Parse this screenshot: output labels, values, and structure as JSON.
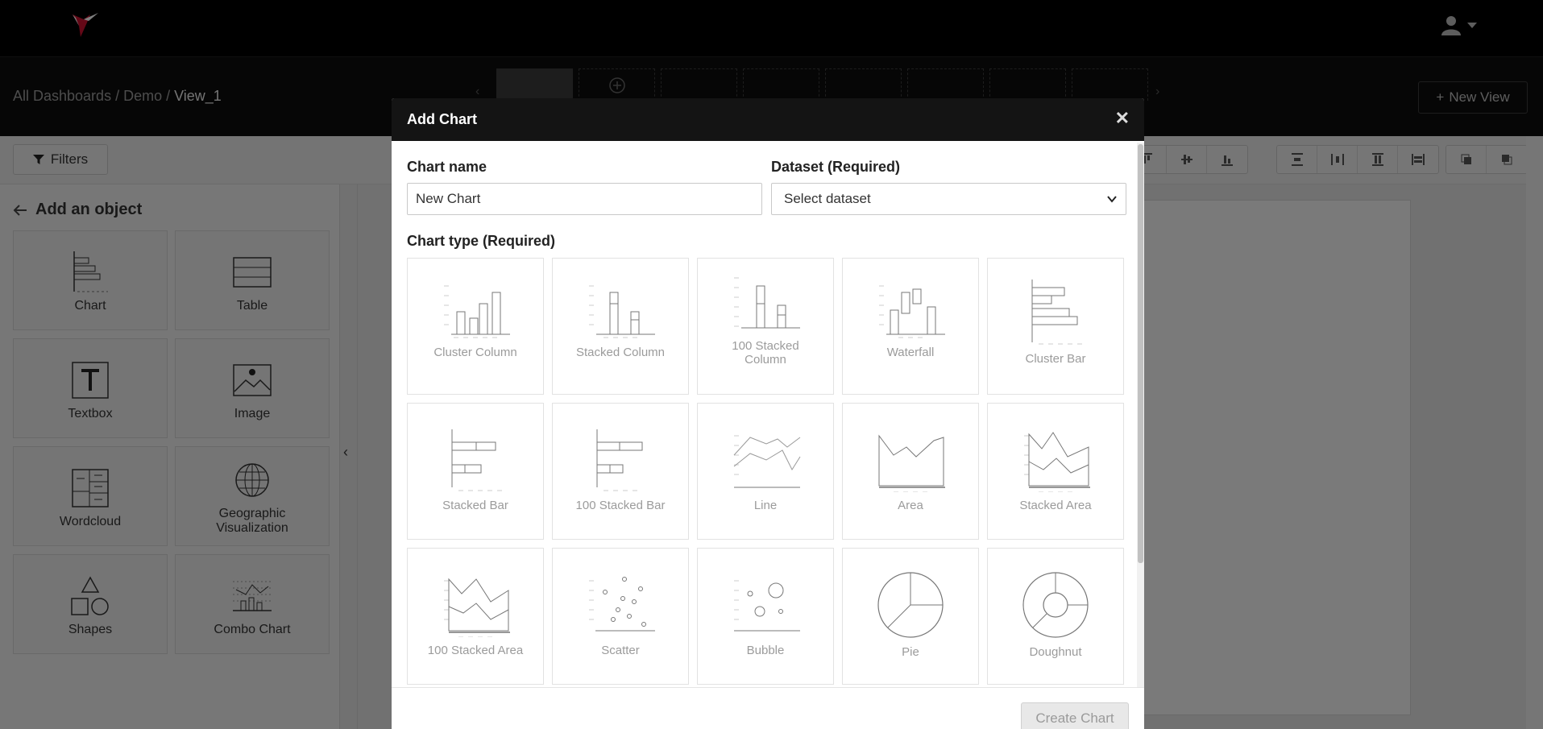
{
  "header": {
    "logo_icon": "hummingbird-logo",
    "user_icon": "user-icon"
  },
  "breadcrumb": {
    "root": "All Dashboards",
    "sep1": " / ",
    "project": "Demo",
    "sep2": " / ",
    "current": "View_1"
  },
  "view_tabs": {
    "count": 8,
    "add_icon": "plus-circle-icon"
  },
  "new_view_label": "New View",
  "toolbar": {
    "filters_label": "Filters"
  },
  "sidebar": {
    "title": "Add an object",
    "objects": [
      "Chart",
      "Table",
      "Textbox",
      "Image",
      "Wordcloud",
      "Geographic Visualization",
      "Shapes",
      "Combo Chart"
    ]
  },
  "modal": {
    "title": "Add Chart",
    "chart_name_label": "Chart name",
    "chart_name_value": "New Chart",
    "dataset_label": "Dataset (Required)",
    "dataset_value": "Select dataset",
    "chart_type_label": "Chart type (Required)",
    "chart_types": [
      "Cluster Column",
      "Stacked Column",
      "100 Stacked Column",
      "Waterfall",
      "Cluster Bar",
      "Stacked Bar",
      "100 Stacked Bar",
      "Line",
      "Area",
      "Stacked Area",
      "100 Stacked Area",
      "Scatter",
      "Bubble",
      "Pie",
      "Doughnut"
    ],
    "create_label": "Create Chart"
  }
}
